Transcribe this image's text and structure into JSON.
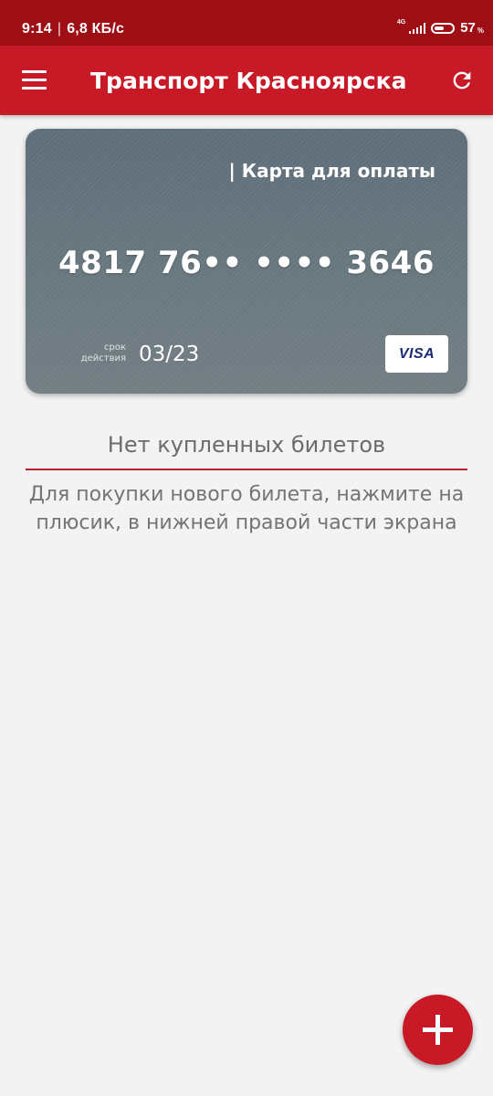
{
  "status_bar": {
    "time": "9:14",
    "separator": "|",
    "speed": "6,8 КБ/с",
    "network": "4G",
    "battery_percent": "57",
    "battery_unit": "%",
    "battery_level": 0.57
  },
  "app_bar": {
    "title": "Транспорт Красноярска",
    "icons": {
      "menu": "hamburger-menu-icon",
      "refresh": "refresh-icon"
    },
    "color": "#c81927"
  },
  "card": {
    "label": "| Карта для оплаты",
    "number": "4817 76•• •••• 3646",
    "expiry_label": "срок действия",
    "expiry": "03/23",
    "brand": "VISA"
  },
  "tickets": {
    "empty_title": "Нет купленных билетов",
    "empty_hint": "Для покупки нового билета, нажмите на плюсик, в нижней правой части экрана"
  },
  "fab": {
    "icon": "plus-icon"
  }
}
